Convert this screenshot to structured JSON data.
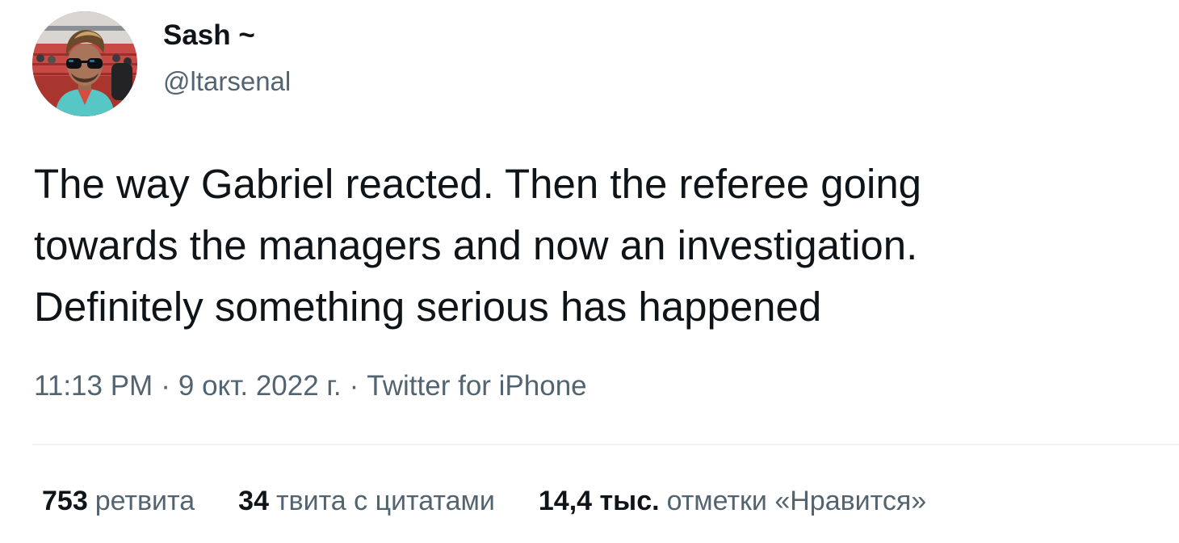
{
  "user": {
    "display_name": "Sash ~",
    "handle": "@ltarsenal"
  },
  "tweet": {
    "lines": [
      "The way Gabriel reacted. Then the referee going",
      "towards the managers and now an investigation.",
      "Definitely something serious has happened"
    ]
  },
  "meta": {
    "time": "11:13 PM",
    "separator": "·",
    "date": "9 окт. 2022 г.",
    "source": "Twitter for iPhone"
  },
  "stats": {
    "retweets": {
      "count": "753",
      "label": "ретвита"
    },
    "quotes": {
      "count": "34",
      "label": "твита с цитатами"
    },
    "likes": {
      "count": "14,4 тыс.",
      "label": "отметки «Нравится»"
    }
  },
  "colors": {
    "text_primary": "#0f1419",
    "text_secondary": "#536471",
    "divider": "#eff3f4"
  }
}
